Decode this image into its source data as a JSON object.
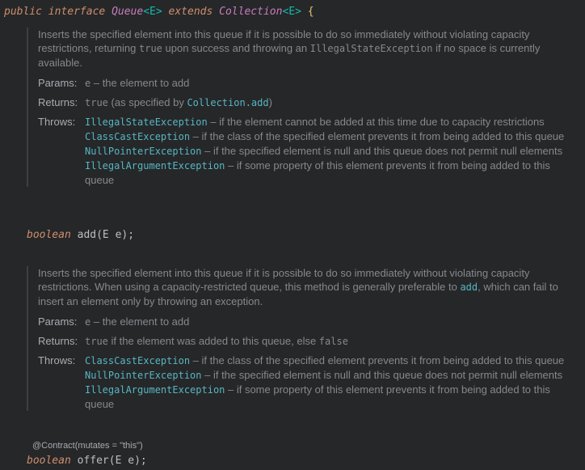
{
  "declaration": {
    "public": "public",
    "interface": "interface",
    "name": "Queue",
    "type_param": "<E>",
    "extends": "extends",
    "parent": "Collection",
    "parent_param": "<E>",
    "brace": "{"
  },
  "add_doc": {
    "desc_1": "Inserts the specified element into this queue if it is possible to do so immediately without violating capacity restrictions, returning ",
    "desc_code_1": "true",
    "desc_2": " upon success and throwing an ",
    "desc_code_2": "IllegalStateException",
    "desc_3": " if no space is currently available.",
    "params_label": "Params:",
    "params_code": "e",
    "params_text": " – the element to add",
    "returns_label": "Returns:",
    "returns_code": "true",
    "returns_text": " (as specified by ",
    "returns_link": "Collection.add",
    "returns_end": ")",
    "throws_label": "Throws:",
    "throws": [
      {
        "name": "IllegalStateException",
        "text": " – if the element cannot be added at this time due to capacity restrictions"
      },
      {
        "name": "ClassCastException",
        "text": " – if the class of the specified element prevents it from being added to this queue"
      },
      {
        "name": "NullPointerException",
        "text": " – if the specified element is null and this queue does not permit null elements"
      },
      {
        "name": "IllegalArgumentException",
        "text": " – if some property of this element prevents it from being added to this queue"
      }
    ]
  },
  "add_sig": {
    "type": "boolean",
    "name": "add",
    "params": "(E e);"
  },
  "offer_doc": {
    "desc_1": "Inserts the specified element into this queue if it is possible to do so immediately without violating capacity restrictions. When using a capacity-restricted queue, this method is generally preferable to ",
    "desc_link": "add",
    "desc_2": ", which can fail to insert an element only by throwing an exception.",
    "params_label": "Params:",
    "params_code": "e",
    "params_text": " – the element to add",
    "returns_label": "Returns:",
    "returns_code_1": "true",
    "returns_text": " if the element was added to this queue, else ",
    "returns_code_2": "false",
    "throws_label": "Throws:",
    "throws": [
      {
        "name": "ClassCastException",
        "text": " – if the class of the specified element prevents it from being added to this queue"
      },
      {
        "name": "NullPointerException",
        "text": " – if the specified element is null and this queue does not permit null elements"
      },
      {
        "name": "IllegalArgumentException",
        "text": " – if some property of this element prevents it from being added to this queue"
      }
    ]
  },
  "annotation": "@Contract(mutates = \"this\")",
  "offer_sig": {
    "type": "boolean",
    "name": "offer",
    "params": "(E e);"
  },
  "colors": {
    "background": "#262729",
    "keyword": "#cf8e6d",
    "interface_name": "#c77dbb",
    "type_param": "#16baac",
    "method": "#56a8f5",
    "doc_text": "#86888d",
    "doc_link": "#56b6c2"
  }
}
